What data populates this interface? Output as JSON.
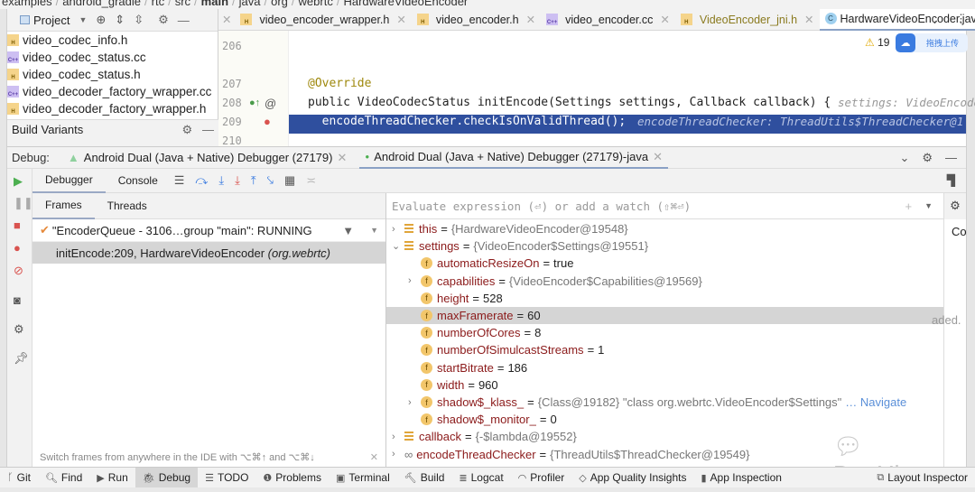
{
  "breadcrumb": [
    "examples",
    "android_gradle",
    "rtc",
    "src",
    "main",
    "java",
    "org",
    "webrtc",
    "HardwareVideoEncoder"
  ],
  "project": {
    "title": "Project",
    "files": [
      {
        "name": "video_codec_info.h",
        "type": "H"
      },
      {
        "name": "video_codec_status.cc",
        "type": "C++"
      },
      {
        "name": "video_codec_status.h",
        "type": "H"
      },
      {
        "name": "video_decoder_factory_wrapper.cc",
        "type": "C++"
      },
      {
        "name": "video_decoder_factory_wrapper.h",
        "type": "H"
      }
    ],
    "build_variants": "Build Variants"
  },
  "editor": {
    "tabs": [
      {
        "label": "video_encoder_wrapper.h",
        "type": "H"
      },
      {
        "label": "video_encoder.h",
        "type": "H"
      },
      {
        "label": "video_encoder.cc",
        "type": "C++"
      },
      {
        "label": "VideoEncoder_jni.h",
        "type": "H"
      },
      {
        "label": "HardwareVideoEncoder.java",
        "type": "C",
        "active": true
      }
    ],
    "warnings": "19",
    "upload_label": "拖拽上传",
    "lines": [
      {
        "num": "206",
        "code": ""
      },
      {
        "num": "207",
        "code": "@Override"
      },
      {
        "num": "208",
        "code": "public VideoCodecStatus initEncode(Settings settings, Callback callback) {",
        "hint": "settings: VideoEncoder"
      },
      {
        "num": "209",
        "code": "  encodeThreadChecker.checkIsOnValidThread();",
        "hint": "encodeThreadChecker: ThreadUtils$ThreadChecker@1"
      },
      {
        "num": "210",
        "code": ""
      }
    ]
  },
  "debug": {
    "label": "Debug:",
    "sessions": [
      "Android Dual (Java + Native) Debugger (27179)",
      "Android Dual (Java + Native) Debugger (27179)-java"
    ],
    "tabs": [
      "Debugger",
      "Console"
    ],
    "frame_tabs": [
      "Frames",
      "Threads"
    ],
    "thread": "\"EncoderQueue - 3106…group \"main\": RUNNING",
    "frame": {
      "method": "initEncode:209, HardwareVideoEncoder",
      "pkg": "(org.webrtc)"
    },
    "hint": "Switch frames from anywhere in the IDE with ⌥⌘↑ and ⌥⌘↓",
    "eval_placeholder": "Evaluate expression (⏎) or add a watch (⇧⌘⏎)",
    "side_text": "Co",
    "loaded_text": "aded.",
    "vars": [
      {
        "name": "this",
        "value": "{HardwareVideoEncoder@19548}",
        "level": 0,
        "exp": ">",
        "icon": "list"
      },
      {
        "name": "settings",
        "value": "{VideoEncoder$Settings@19551}",
        "level": 0,
        "exp": "v",
        "icon": "list"
      },
      {
        "name": "automaticResizeOn",
        "value": "true",
        "level": 1,
        "exp": "",
        "icon": "f"
      },
      {
        "name": "capabilities",
        "value": "{VideoEncoder$Capabilities@19569}",
        "level": 1,
        "exp": ">",
        "icon": "f"
      },
      {
        "name": "height",
        "value": "528",
        "level": 1,
        "exp": "",
        "icon": "f"
      },
      {
        "name": "maxFramerate",
        "value": "60",
        "level": 1,
        "exp": "",
        "icon": "f",
        "selected": true
      },
      {
        "name": "numberOfCores",
        "value": "8",
        "level": 1,
        "exp": "",
        "icon": "f"
      },
      {
        "name": "numberOfSimulcastStreams",
        "value": "1",
        "level": 1,
        "exp": "",
        "icon": "f"
      },
      {
        "name": "startBitrate",
        "value": "186",
        "level": 1,
        "exp": "",
        "icon": "f"
      },
      {
        "name": "width",
        "value": "960",
        "level": 1,
        "exp": "",
        "icon": "f"
      },
      {
        "name": "shadow$_klass_",
        "value": "{Class@19182} \"class org.webrtc.VideoEncoder$Settings\"",
        "level": 1,
        "exp": ">",
        "icon": "f",
        "link": "… Navigate"
      },
      {
        "name": "shadow$_monitor_",
        "value": "0",
        "level": 1,
        "exp": "",
        "icon": "f"
      },
      {
        "name": "callback",
        "value": "{-$lambda@19552}",
        "level": 0,
        "exp": ">",
        "icon": "list"
      },
      {
        "name": "encodeThreadChecker",
        "value": "{ThreadUtils$ThreadChecker@19549}",
        "level": 0,
        "exp": ">",
        "icon": "oo"
      }
    ]
  },
  "watermark": "DevYk",
  "toolwindows": [
    {
      "label": "Git",
      "icon": "ᚴ"
    },
    {
      "label": "Find",
      "icon": "🔍︎"
    },
    {
      "label": "Run",
      "icon": "▶"
    },
    {
      "label": "Debug",
      "icon": "🐞︎",
      "active": true
    },
    {
      "label": "TODO",
      "icon": "☰"
    },
    {
      "label": "Problems",
      "icon": "❶"
    },
    {
      "label": "Terminal",
      "icon": "▣"
    },
    {
      "label": "Build",
      "icon": "🔨︎"
    },
    {
      "label": "Logcat",
      "icon": "≣"
    },
    {
      "label": "Profiler",
      "icon": "◠"
    },
    {
      "label": "App Quality Insights",
      "icon": "◇"
    },
    {
      "label": "App Inspection",
      "icon": "▮"
    },
    {
      "label": "Layout Inspector",
      "icon": "⧉"
    }
  ],
  "colors": {
    "selection": "#2f4f9e",
    "var_name": "#8b1a1a",
    "link": "#5a8fd8",
    "resume": "#4caf50",
    "stop": "#d9534f"
  }
}
